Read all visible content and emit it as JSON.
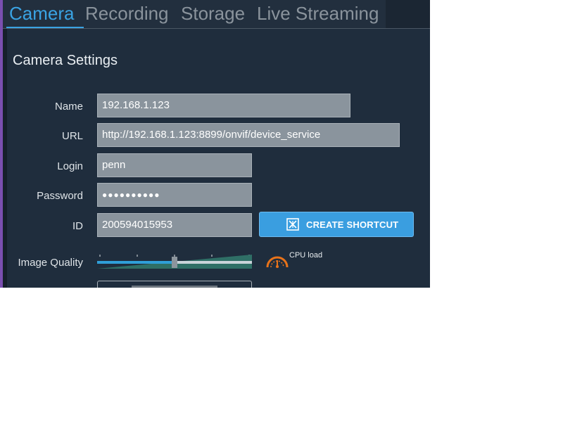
{
  "tabs": [
    {
      "label": "Camera",
      "active": true
    },
    {
      "label": "Recording",
      "active": false
    },
    {
      "label": "Storage",
      "active": false
    },
    {
      "label": "Live Streaming",
      "active": false
    }
  ],
  "section_title": "Camera Settings",
  "form": {
    "name": {
      "label": "Name",
      "value": "192.168.1.123"
    },
    "url": {
      "label": "URL",
      "value": "http://192.168.1.123:8899/onvif/device_service"
    },
    "login": {
      "label": "Login",
      "value": "penn"
    },
    "password": {
      "label": "Password",
      "value": "●●●●●●●●●●"
    },
    "id": {
      "label": "ID",
      "value": "200594015953"
    }
  },
  "shortcut_button": {
    "label": "CREATE SHORTCUT",
    "icon": "shortcut-icon"
  },
  "image_quality": {
    "label": "Image Quality",
    "level": 0.5,
    "cpu_label": "CPU load",
    "cpu_icon": "gauge-icon"
  },
  "colors": {
    "accent": "#3aa3e3",
    "background": "#1f2d3d",
    "field": "#8a949d",
    "button": "#3a9ee0",
    "cpu": "#e8731a"
  }
}
